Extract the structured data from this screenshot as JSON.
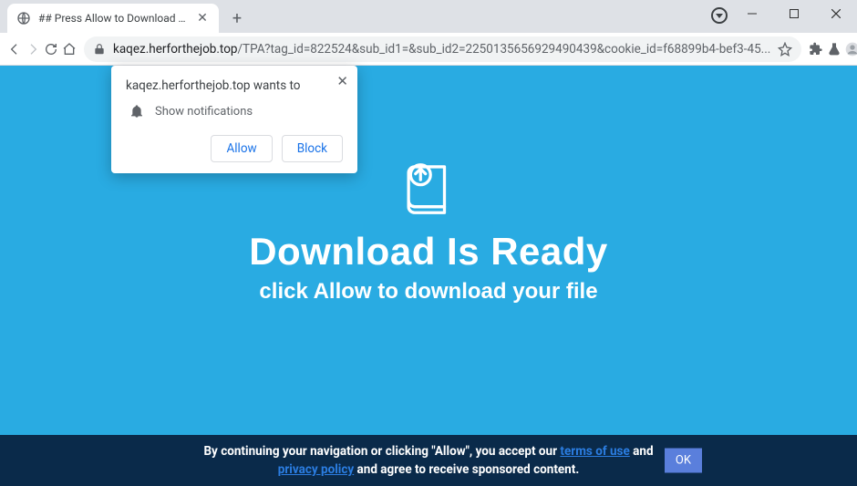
{
  "browser": {
    "tab_title": "## Press Allow to Download ##",
    "url_host": "kaqez.herforthejob.top",
    "url_path": "/TPA?tag_id=822524&sub_id1=&sub_id2=2250135656929490439&cookie_id=f68899b4-bef3-45..."
  },
  "permission": {
    "origin_text": "kaqez.herforthejob.top wants to",
    "item": "Show notifications",
    "allow": "Allow",
    "block": "Block"
  },
  "hero": {
    "title": "Download Is Ready",
    "subtitle": "click Allow to download your file"
  },
  "cookie": {
    "pre": "By continuing your navigation or clicking \"Allow\", you accept our ",
    "terms": "terms of use",
    "mid": " and ",
    "privacy": "privacy policy",
    "post": " and agree to receive sponsored content.",
    "ok": "OK"
  }
}
